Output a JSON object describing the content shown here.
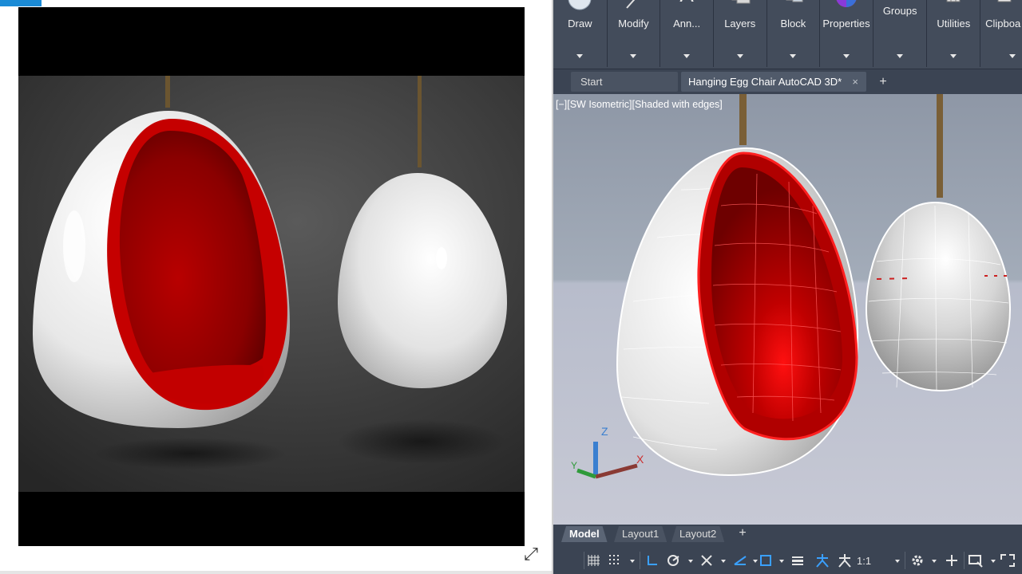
{
  "reference": {
    "expand_icon": "expand-diagonal-icon"
  },
  "ribbon": {
    "panels": [
      {
        "label": "Draw",
        "icon": "draw-circle-icon"
      },
      {
        "label": "Modify",
        "icon": "modify-icon"
      },
      {
        "label": "Ann...",
        "icon": "annotation-text-icon"
      },
      {
        "label": "Layers",
        "icon": "layers-icon"
      },
      {
        "label": "Block",
        "icon": "block-icon"
      },
      {
        "label": "Properties",
        "icon": "properties-color-wheel-icon"
      },
      {
        "label": "Groups",
        "icon": "groups-icon"
      },
      {
        "label": "Utilities",
        "icon": "utilities-calculator-icon"
      },
      {
        "label": "Clipboa",
        "icon": "clipboard-icon"
      }
    ]
  },
  "file_tabs": {
    "start": "Start",
    "active": "Hanging Egg Chair AutoCAD 3D*",
    "close": "×",
    "new": "+"
  },
  "viewport": {
    "label": "[−][SW Isometric][Shaded with edges]",
    "ucs": {
      "x": "X",
      "y": "Y",
      "z": "Z"
    }
  },
  "layout_tabs": {
    "model": "Model",
    "layout1": "Layout1",
    "layout2": "Layout2",
    "add": "+"
  },
  "statusbar": {
    "scale": "1:1",
    "icons": [
      "grid-icon",
      "snap-icon",
      "ortho-icon",
      "polar-icon",
      "osnap-icon",
      "isodraft-icon",
      "annotation-scale-icon",
      "lineweight-icon",
      "workspace-gear-icon",
      "customize-plus-icon",
      "viewport-icon",
      "fullscreen-icon"
    ]
  },
  "colors": {
    "cad_bg": "#3b4453",
    "accent": "#1b8bd6",
    "shell_red": "#cc0000",
    "shell_white": "#ffffff"
  }
}
